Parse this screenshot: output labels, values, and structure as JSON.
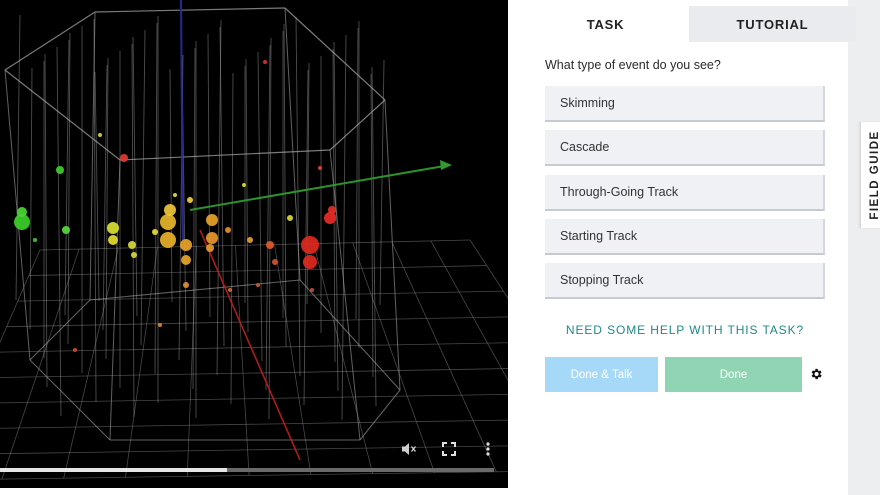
{
  "video": {
    "progress_fraction": 0.46,
    "controls": {
      "mute_icon": "speaker-muted-icon",
      "fullscreen_icon": "fullscreen-icon",
      "menu_icon": "more-vertical-icon"
    },
    "colors": {
      "x_axis": "#2f9a2f",
      "y_axis": "#c01e1e",
      "z_axis": "#2a2a9a",
      "grid": "#777777"
    }
  },
  "tabs": [
    {
      "label": "TASK",
      "active": true
    },
    {
      "label": "TUTORIAL",
      "active": false
    }
  ],
  "task": {
    "question": "What type of event do you see?",
    "answers": [
      {
        "label": "Skimming"
      },
      {
        "label": "Cascade"
      },
      {
        "label": "Through-Going Track"
      },
      {
        "label": "Starting Track"
      },
      {
        "label": "Stopping Track"
      }
    ],
    "help_link": "NEED SOME HELP WITH THIS TASK?",
    "done_talk_label": "Done & Talk",
    "done_label": "Done",
    "gear_icon": "gear-icon"
  },
  "field_guide": {
    "label": "FIELD GUIDE"
  },
  "colors": {
    "accent": "#1f8a88",
    "done_talk_bg": "#a6d9f7",
    "done_bg": "#8fd4b3",
    "answer_bg": "#eff1f4"
  }
}
